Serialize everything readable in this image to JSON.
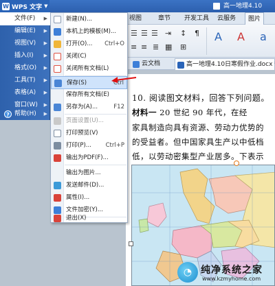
{
  "app": {
    "menu_button_label": "WPS 文字",
    "document_title_short": "高一地理4.10"
  },
  "ribbon_tabs": [
    "视图",
    "章节",
    "开发工具",
    "云服务",
    "图片"
  ],
  "ribbon_tab_active": "图片",
  "doc_tabs": {
    "cloud": "云文档",
    "document": "高一地理4.10日寒假作业.docx *"
  },
  "left_menu": [
    {
      "label": "文件(F)",
      "active": true
    },
    {
      "label": "编辑(E)"
    },
    {
      "label": "视图(V)"
    },
    {
      "label": "插入(I)"
    },
    {
      "label": "格式(O)"
    },
    {
      "label": "工具(T)"
    },
    {
      "label": "表格(A)"
    },
    {
      "label": "窗口(W)"
    },
    {
      "label": "帮助(H)"
    }
  ],
  "file_menu": [
    {
      "label": "新建(N)...",
      "icon": "new-doc-icon",
      "color": "#ffffff"
    },
    {
      "label": "本机上的模板(M)...",
      "icon": "template-icon",
      "color": "#3d7fd8"
    },
    {
      "label": "打开(O)...",
      "shortcut": "Ctrl+O",
      "icon": "folder-open-icon",
      "color": "#f0b63a"
    },
    {
      "label": "关闭(C)",
      "icon": "close-doc-icon",
      "color": "#e05040"
    },
    {
      "label": "关闭所有文档(L)",
      "icon": "close-all-icon",
      "color": "#e05040"
    },
    {
      "label": "保存(S)",
      "shortcut": "Ctrl",
      "icon": "save-icon",
      "color": "#4a86d6",
      "hover": true
    },
    {
      "label": "保存所有文档(E)"
    },
    {
      "label": "另存为(A)...",
      "shortcut": "F12",
      "icon": "save-as-icon",
      "color": "#4a86d6"
    },
    {
      "label": "页面设置(U)...",
      "disabled": true,
      "icon": "page-setup-icon",
      "color": "#c9c9c9"
    },
    {
      "label": "打印预览(V)",
      "icon": "print-preview-icon",
      "color": "#7d8da0"
    },
    {
      "label": "打印(P)...",
      "shortcut": "Ctrl+P",
      "icon": "print-icon",
      "color": "#7d8da0"
    },
    {
      "label": "输出为PDF(F)...",
      "icon": "pdf-icon",
      "color": "#d9433a"
    },
    {
      "label": "输出为图片..."
    },
    {
      "label": "发送邮件(D)...",
      "icon": "mail-icon",
      "color": "#3d9ad8"
    },
    {
      "label": "属性(I)...",
      "icon": "properties-icon",
      "color": "#d9433a"
    },
    {
      "label": "文件加密(Y)...",
      "icon": "encrypt-icon",
      "color": "#3d7fd8",
      "chevron": true
    },
    {
      "label": "退出(X)",
      "icon": "exit-icon",
      "color": "#d9433a"
    }
  ],
  "document": {
    "question": "10. 阅读图文材料，回答下列问题。",
    "para1_label": "材料一",
    "para1_text": "  20 世纪 90 年代，在经",
    "para2": "家具制造向具有资源、劳动力优势的",
    "para3": "的受益者。但中国家具生产以中低档",
    "para4": "低，以劳动密集型产业居多。下表示"
  },
  "watermark": {
    "name": "纯净系统之家",
    "url": "www.kzmyhome.com"
  }
}
